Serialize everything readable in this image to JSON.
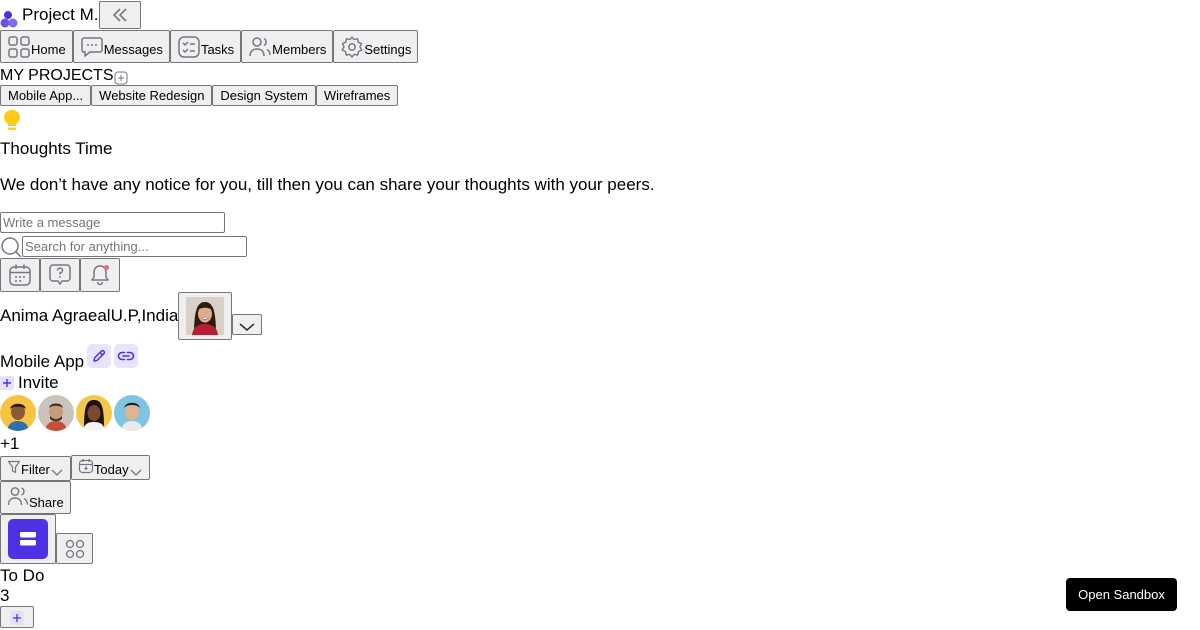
{
  "app": {
    "brand_name": "Project M.",
    "accent_color": "#5030e5"
  },
  "nav": [
    {
      "label": "Home",
      "icon": "grid-icon"
    },
    {
      "label": "Messages",
      "icon": "message-icon"
    },
    {
      "label": "Tasks",
      "icon": "task-square-icon"
    },
    {
      "label": "Members",
      "icon": "members-icon"
    },
    {
      "label": "Settings",
      "icon": "gear-icon"
    }
  ],
  "projects": {
    "heading": "MY PROJECTS",
    "items": [
      "Mobile App...",
      "Website Redesign",
      "Design System",
      "Wireframes"
    ]
  },
  "thoughts": {
    "title": "Thoughts Time",
    "text": "We don’t have any notice for you, till then you can share your thoughts with your peers.",
    "input_placeholder": "Write a message"
  },
  "search": {
    "placeholder": "Search for anything..."
  },
  "user": {
    "name": "Anima Agraeal",
    "location": "U.P,India"
  },
  "project": {
    "title": "Mobile App",
    "invite_label": "Invite",
    "members_extra": "+1",
    "filter_label": "Filter",
    "today_label": "Today",
    "share_label": "Share"
  },
  "board": {
    "column_title": "To Do",
    "column_count": "3"
  },
  "sandbox": {
    "label": "Open Sandbox"
  }
}
